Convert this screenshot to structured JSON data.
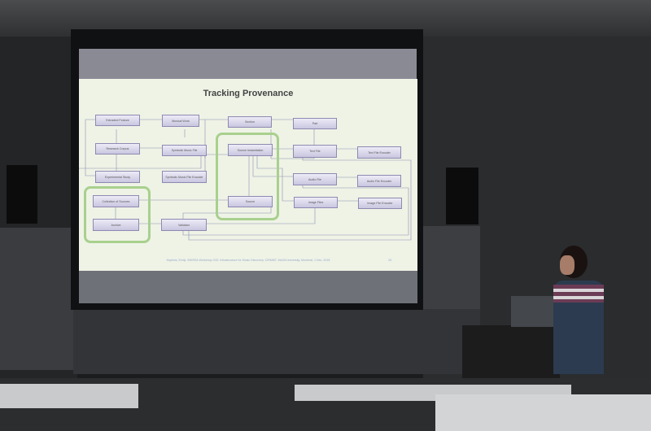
{
  "slide": {
    "title": "Tracking Provenance",
    "footer": "Hopkins, Emily. SIMSSA Workshop XVII: Infrastructure for Music Discovery. CIRMMT, McGill University, Montreal, 1 Dec. 2018",
    "page_number": "15",
    "entities": {
      "extracted_feature": "Extracted Feature",
      "musical_work": "Musical Work",
      "section": "Section",
      "part": "Part",
      "research_corpus": "Research Corpus",
      "symbolic_music_file": "Symbolic Music File",
      "source_instantiation": "Source Instantiation",
      "text_file": "Text File",
      "text_file_encoder": "Text File Encoder",
      "experimental_study": "Experimental Study",
      "symbolic_music_file_encoder": "Symbolic Music File Encoder",
      "audio_file": "Audio File",
      "audio_file_encoder": "Audio File Encoder",
      "collection_of_sources": "Collection of Sources",
      "archive": "Archive",
      "source": "Source",
      "image_files": "Image Files",
      "image_file_encoder": "Image File Encoder",
      "validator": "Validator"
    },
    "highlight_color": "#a9d08e"
  }
}
